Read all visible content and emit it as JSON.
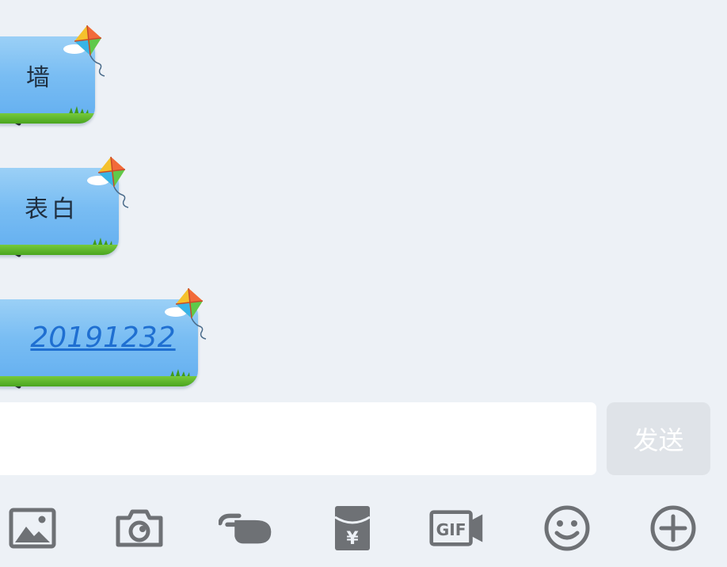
{
  "messages": [
    {
      "text": "墙",
      "is_link": false
    },
    {
      "text": "表白",
      "is_link": false
    },
    {
      "text": "20191232",
      "is_link": true
    }
  ],
  "input": {
    "value": "",
    "placeholder": ""
  },
  "send_label": "发送",
  "toolbar": [
    {
      "icon": "image-icon"
    },
    {
      "icon": "camera-icon"
    },
    {
      "icon": "poke-icon"
    },
    {
      "icon": "red-packet-icon",
      "glyph": "¥"
    },
    {
      "icon": "gif-icon",
      "glyph": "GIF"
    },
    {
      "icon": "emoji-icon"
    },
    {
      "icon": "plus-icon"
    }
  ],
  "colors": {
    "background": "#edf1f6",
    "bubble_sky": "#79bdf3",
    "bubble_grass": "#4aa51f",
    "link": "#1f6fd1",
    "icon_gray": "#6e7175",
    "send_button": "#dfe3e8"
  }
}
